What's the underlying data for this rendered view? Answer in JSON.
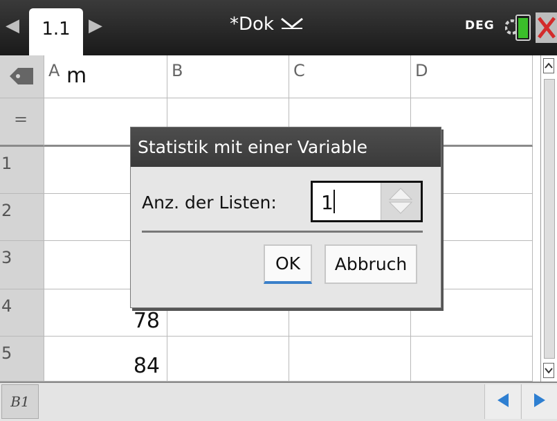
{
  "topbar": {
    "tab_label": "1.1",
    "document_title": "*Dok",
    "angle_mode": "DEG"
  },
  "sheet": {
    "column_headers": [
      "A",
      "B",
      "C",
      "D"
    ],
    "column_a_name": "m",
    "formula_row_symbol": "=",
    "row_labels": [
      "1",
      "2",
      "3",
      "4",
      "5"
    ],
    "column_a_values": [
      "",
      "",
      "",
      "78",
      "84"
    ]
  },
  "bottombar": {
    "cell_reference": "B1",
    "entry_value": ""
  },
  "dialog": {
    "title": "Statistik mit einer Variable",
    "field_label": "Anz. der Listen:",
    "field_value": "1",
    "ok_label": "OK",
    "cancel_label": "Abbruch"
  },
  "colors": {
    "topbar_bg": "#2a2a2a",
    "close_red": "#d32b2b",
    "battery_green": "#3bbf2a",
    "nav_arrow_blue": "#2e7fd1",
    "ok_focus_blue": "#3a7fc9"
  },
  "icons": {
    "tab_prev": "left-arrow-icon",
    "tab_next": "right-arrow-icon",
    "title_menu": "chevron-down-icon",
    "battery": "battery-icon",
    "close": "close-icon",
    "variable_tag": "tag-icon",
    "scroll_up": "scroll-up-icon",
    "scroll_down": "scroll-down-icon",
    "nav_left": "triangle-left-icon",
    "nav_right": "triangle-right-icon",
    "spinner": "spinner-up-down-icon"
  }
}
